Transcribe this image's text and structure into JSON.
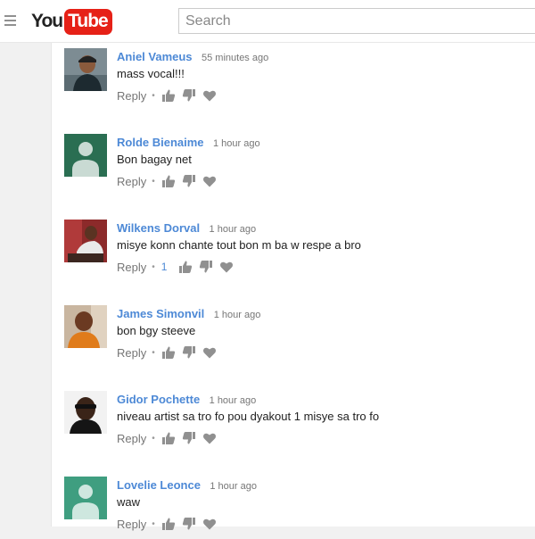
{
  "header": {
    "logo_you": "You",
    "logo_tube": "Tube",
    "search_placeholder": "Search"
  },
  "comments": [
    {
      "author": "Aniel Vameus",
      "time": "55 minutes ago",
      "text": "mass vocal!!!",
      "reply": "Reply",
      "likes": "",
      "avatar": "photo"
    },
    {
      "author": "Rolde Bienaime",
      "time": "1 hour ago",
      "text": "Bon bagay net",
      "reply": "Reply",
      "likes": "",
      "avatar": "default-green"
    },
    {
      "author": "Wilkens Dorval",
      "time": "1 hour ago",
      "text": "misye konn chante tout bon m ba w respe a bro",
      "reply": "Reply",
      "likes": "1",
      "avatar": "photo"
    },
    {
      "author": "James Simonvil",
      "time": "1 hour ago",
      "text": "bon bgy steeve",
      "reply": "Reply",
      "likes": "",
      "avatar": "photo"
    },
    {
      "author": "Gidor Pochette",
      "time": "1 hour ago",
      "text": "niveau artist sa tro fo pou dyakout 1 misye sa tro fo",
      "reply": "Reply",
      "likes": "",
      "avatar": "photo"
    },
    {
      "author": "Lovelie Leonce",
      "time": "1 hour ago",
      "text": "waw",
      "reply": "Reply",
      "likes": "",
      "avatar": "default-teal"
    }
  ],
  "icons": [
    "menu-icon",
    "thumbs-up-icon",
    "thumbs-down-icon",
    "heart-icon"
  ],
  "colors": {
    "author": "#4d89d6",
    "brand_red": "#e62117",
    "avatar_green": "#2a6e52",
    "avatar_teal": "#3f9e80"
  }
}
